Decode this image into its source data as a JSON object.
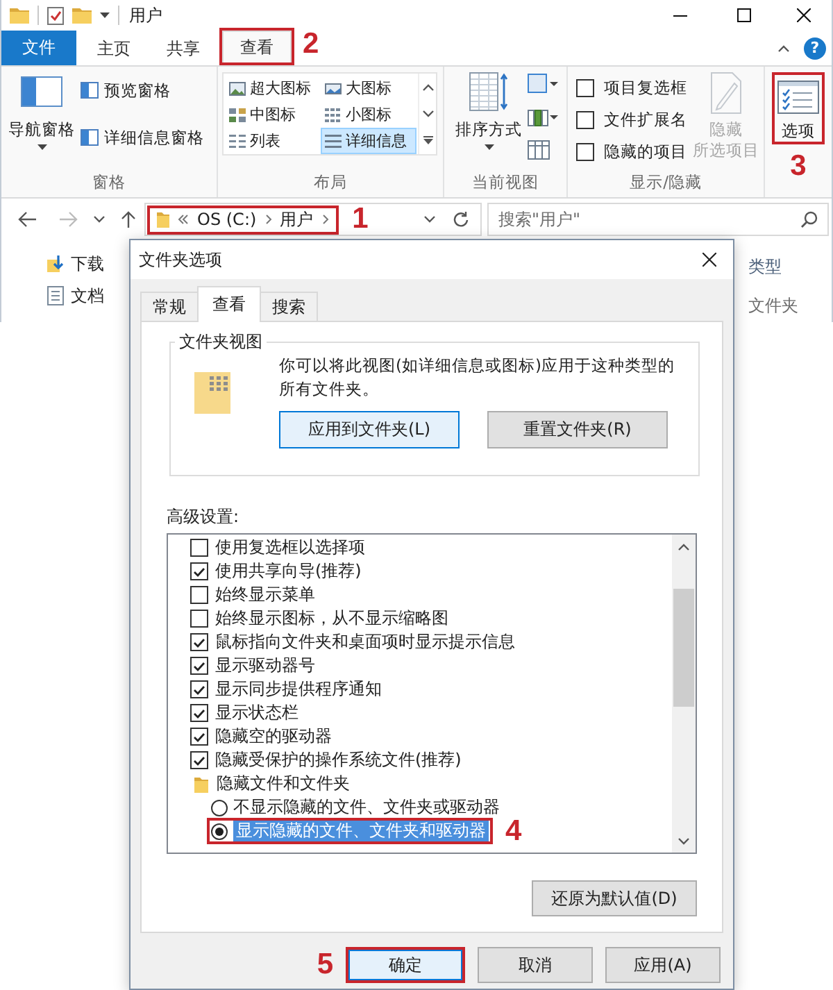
{
  "window": {
    "title": "用户"
  },
  "ribbon_tabs": {
    "file_menu": "文件",
    "tabs": [
      {
        "label": "主页",
        "selected": false
      },
      {
        "label": "共享",
        "selected": false
      },
      {
        "label": "查看",
        "selected": true,
        "callout": "2"
      }
    ],
    "help": "?"
  },
  "ribbon": {
    "panes": {
      "label": "窗格",
      "navigation_pane": "导航窗格",
      "buttons": [
        "预览窗格",
        "详细信息窗格"
      ]
    },
    "layout": {
      "label": "布局",
      "options": [
        {
          "label": "超大图标",
          "selected": false
        },
        {
          "label": "大图标",
          "selected": false
        },
        {
          "label": "中图标",
          "selected": false
        },
        {
          "label": "小图标",
          "selected": false
        },
        {
          "label": "列表",
          "selected": false
        },
        {
          "label": "详细信息",
          "selected": true
        }
      ]
    },
    "current_view": {
      "label": "当前视图",
      "sort_button": "排序方式"
    },
    "show_hide": {
      "label": "显示/隐藏",
      "checkboxes": [
        {
          "label": "项目复选框",
          "checked": false
        },
        {
          "label": "文件扩展名",
          "checked": false
        },
        {
          "label": "隐藏的项目",
          "checked": false
        }
      ],
      "hide_selected": {
        "lines": [
          "隐藏",
          "所选项目"
        ],
        "disabled": true
      }
    },
    "options": {
      "button": "选项",
      "callout": "3"
    }
  },
  "address_bar": {
    "path": [
      "OS (C:)",
      "用户"
    ],
    "callout": "1"
  },
  "search": {
    "placeholder": "搜索\"用户\""
  },
  "nav_pane": [
    {
      "label": "下载",
      "kind": "downloads"
    },
    {
      "label": "文档",
      "kind": "documents"
    }
  ],
  "file_list": {
    "columns": [
      "类型"
    ],
    "rows": [
      [
        "文件夹"
      ]
    ]
  },
  "dialog": {
    "title": "文件夹选项",
    "tabs": [
      {
        "label": "常规",
        "selected": false
      },
      {
        "label": "查看",
        "selected": true
      },
      {
        "label": "搜索",
        "selected": false
      }
    ],
    "folder_views": {
      "heading": "文件夹视图",
      "description": "你可以将此视图(如详细信息或图标)应用于这种类型的所有文件夹。",
      "buttons": [
        {
          "label": "应用到文件夹(L)",
          "focused": true
        },
        {
          "label": "重置文件夹(R)",
          "focused": false
        }
      ]
    },
    "advanced": {
      "heading": "高级设置:",
      "items": [
        {
          "kind": "checkbox",
          "label": "使用复选框以选择项",
          "checked": false
        },
        {
          "kind": "checkbox",
          "label": "使用共享向导(推荐)",
          "checked": true
        },
        {
          "kind": "checkbox",
          "label": "始终显示菜单",
          "checked": false
        },
        {
          "kind": "checkbox",
          "label": "始终显示图标，从不显示缩略图",
          "checked": false
        },
        {
          "kind": "checkbox",
          "label": "鼠标指向文件夹和桌面项时显示提示信息",
          "checked": true
        },
        {
          "kind": "checkbox",
          "label": "显示驱动器号",
          "checked": true
        },
        {
          "kind": "checkbox",
          "label": "显示同步提供程序通知",
          "checked": true
        },
        {
          "kind": "checkbox",
          "label": "显示状态栏",
          "checked": true
        },
        {
          "kind": "checkbox",
          "label": "隐藏空的驱动器",
          "checked": true
        },
        {
          "kind": "checkbox",
          "label": "隐藏受保护的操作系统文件(推荐)",
          "checked": true
        },
        {
          "kind": "group",
          "label": "隐藏文件和文件夹",
          "children": [
            {
              "kind": "radio",
              "label": "不显示隐藏的文件、文件夹或驱动器",
              "selected": false
            },
            {
              "kind": "radio",
              "label": "显示隐藏的文件、文件夹和驱动器",
              "selected": true,
              "callout": "4"
            }
          ]
        }
      ]
    },
    "restore_button": "还原为默认值(D)",
    "buttons": [
      {
        "label": "确定",
        "default": true,
        "callout": "5"
      },
      {
        "label": "取消",
        "default": false
      },
      {
        "label": "应用(A)",
        "default": false
      }
    ]
  }
}
